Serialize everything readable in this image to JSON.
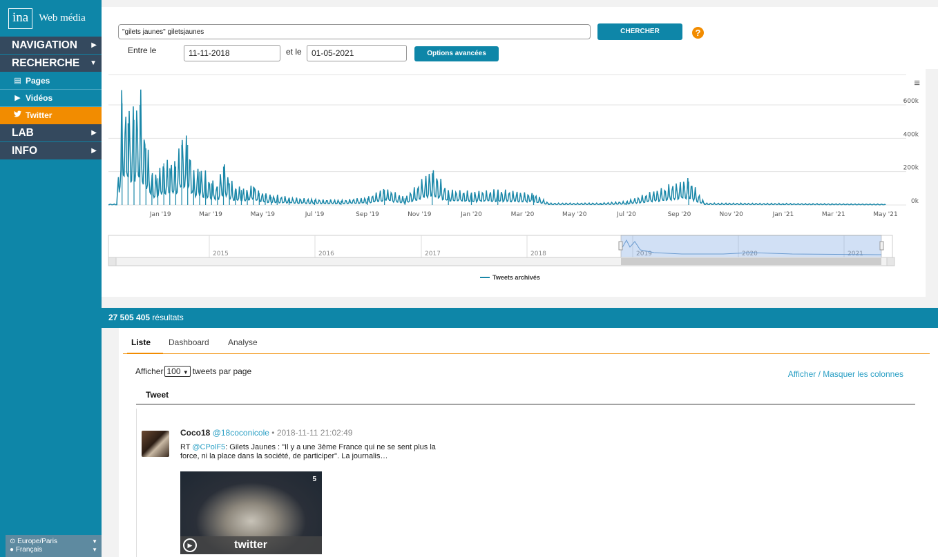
{
  "sidebar": {
    "logo_box": "ina",
    "logo_text": "Web média",
    "sections": [
      {
        "label": "NAVIGATION",
        "arrow": "▶"
      },
      {
        "label": "RECHERCHE",
        "arrow": "▼"
      },
      {
        "label": "LAB",
        "arrow": "▶"
      },
      {
        "label": "INFO",
        "arrow": "▶"
      }
    ],
    "sub_items": [
      {
        "label": "Pages",
        "icon": "newspaper-icon",
        "glyph": "▤"
      },
      {
        "label": "Vidéos",
        "icon": "youtube-icon",
        "glyph": "▶"
      },
      {
        "label": "Twitter",
        "icon": "twitter-icon",
        "glyph": "♥"
      }
    ],
    "timezone": "Europe/Paris",
    "language": "Français"
  },
  "search": {
    "query": "\"gilets jaunes\" giletsjaunes",
    "submit_label": "CHERCHER",
    "help_label": "?",
    "from_label": "Entre le",
    "from_value": "11-11-2018",
    "to_label": "et le",
    "to_value": "01-05-2021",
    "options_label": "Options avancées"
  },
  "chart_data": {
    "type": "line",
    "title": "",
    "xlabel": "",
    "ylabel": "",
    "x_ticks": [
      "Jan '19",
      "Mar '19",
      "May '19",
      "Jul '19",
      "Sep '19",
      "Nov '19",
      "Jan '20",
      "Mar '20",
      "May '20",
      "Jul '20",
      "Sep '20",
      "Nov '20",
      "Jan '21",
      "Mar '21",
      "May '21"
    ],
    "y_ticks": [
      "0k",
      "200k",
      "400k",
      "600k"
    ],
    "ylim": [
      0,
      600000
    ],
    "navigator_ticks": [
      "2015",
      "2016",
      "2017",
      "2018",
      "2019",
      "2020",
      "2021"
    ],
    "series": [
      {
        "name": "Tweets archivés",
        "color": "#1a87a8",
        "points": [
          [
            "2018-11-11",
            20000
          ],
          [
            "2018-11-17",
            610000
          ],
          [
            "2018-11-24",
            490000
          ],
          [
            "2018-12-01",
            510000
          ],
          [
            "2018-12-08",
            600000
          ],
          [
            "2018-12-15",
            340000
          ],
          [
            "2018-12-22",
            180000
          ],
          [
            "2018-12-29",
            160000
          ],
          [
            "2019-01-05",
            250000
          ],
          [
            "2019-01-12",
            220000
          ],
          [
            "2019-01-19",
            230000
          ],
          [
            "2019-01-26",
            360000
          ],
          [
            "2019-02-02",
            360000
          ],
          [
            "2019-02-09",
            180000
          ],
          [
            "2019-02-16",
            200000
          ],
          [
            "2019-02-23",
            170000
          ],
          [
            "2019-03-02",
            130000
          ],
          [
            "2019-03-09",
            110000
          ],
          [
            "2019-03-16",
            230000
          ],
          [
            "2019-03-23",
            130000
          ],
          [
            "2019-03-30",
            100000
          ],
          [
            "2019-04-06",
            90000
          ],
          [
            "2019-04-13",
            80000
          ],
          [
            "2019-04-20",
            110000
          ],
          [
            "2019-04-27",
            70000
          ],
          [
            "2019-05-04",
            60000
          ],
          [
            "2019-05-11",
            50000
          ],
          [
            "2019-05-18",
            50000
          ],
          [
            "2019-06-01",
            40000
          ],
          [
            "2019-07-01",
            30000
          ],
          [
            "2019-08-01",
            25000
          ],
          [
            "2019-09-01",
            40000
          ],
          [
            "2019-09-21",
            90000
          ],
          [
            "2019-10-15",
            40000
          ],
          [
            "2019-11-16",
            190000
          ],
          [
            "2019-12-05",
            80000
          ],
          [
            "2020-01-01",
            70000
          ],
          [
            "2020-02-01",
            80000
          ],
          [
            "2020-03-14",
            60000
          ],
          [
            "2020-04-01",
            10000
          ],
          [
            "2020-06-01",
            10000
          ],
          [
            "2020-07-01",
            20000
          ],
          [
            "2020-09-12",
            140000
          ],
          [
            "2020-10-01",
            10000
          ],
          [
            "2021-01-01",
            8000
          ],
          [
            "2021-05-01",
            5000
          ]
        ]
      }
    ],
    "legend": "bottom-center"
  },
  "results": {
    "count": "27 505 405",
    "label": "résultats"
  },
  "tabs": [
    "Liste",
    "Dashboard",
    "Analyse"
  ],
  "list": {
    "show_label": "Afficher",
    "per_page_value": "100",
    "per_page_suffix": "tweets par page",
    "toggle_columns": "Afficher / Masquer les colonnes",
    "column_tweet": "Tweet"
  },
  "tweet": {
    "author": "Coco18",
    "handle": "@18coconicole",
    "sep": "•",
    "date": "2018-11-11 21:02:49",
    "prefix": "RT",
    "mention": "@CPolF5",
    "text": ": Gilets Jaunes : \"Il y a une 3ème France qui ne se sent plus la force, ni la place dans la société, de participer\". La journalis…",
    "media_badge": "5",
    "media_watermark": "twitter"
  }
}
